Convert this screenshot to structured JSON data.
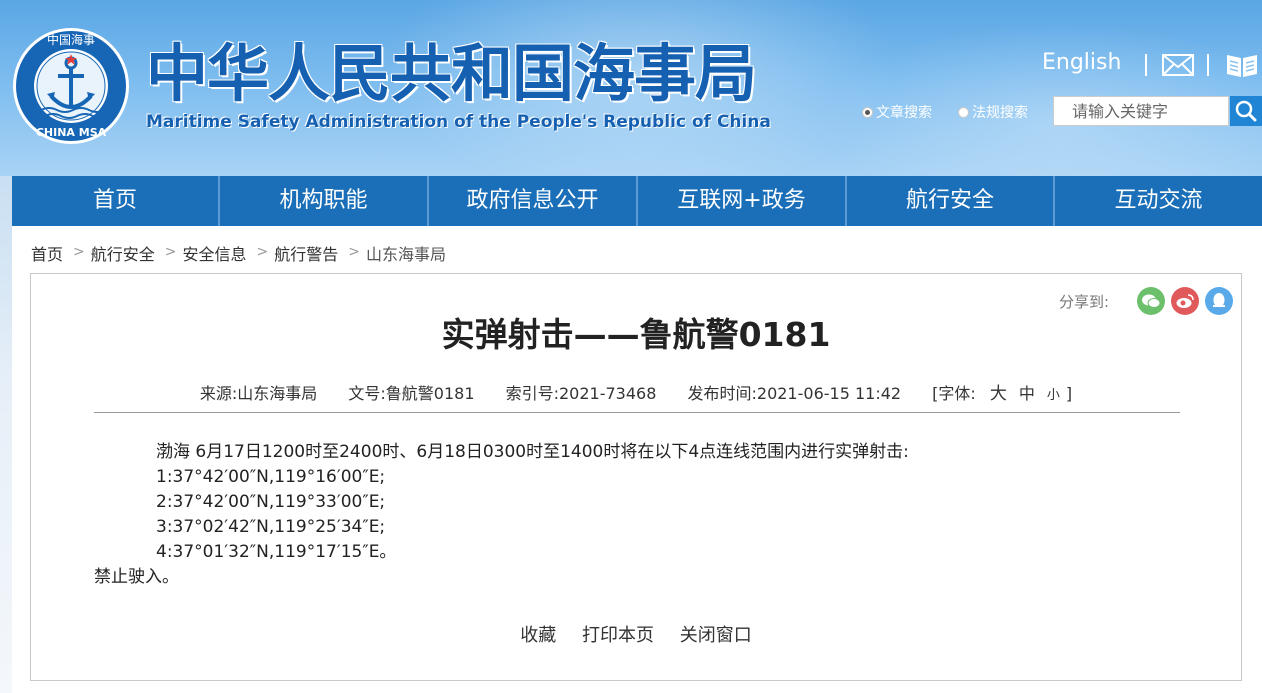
{
  "header": {
    "title_cn": "中华人民共和国海事局",
    "title_en": "Maritime Safety Administration of the People's Republic of China",
    "emblem_text_top": "中国海事",
    "emblem_text_bottom": "CHINA MSA",
    "language_link": "English",
    "icons": [
      "mail-icon",
      "book-icon",
      "search-icon"
    ],
    "search": {
      "options": [
        "文章搜索",
        "法规搜索"
      ],
      "selected": "文章搜索",
      "placeholder": "请输入关键字"
    }
  },
  "nav": {
    "items": [
      "首页",
      "机构职能",
      "政府信息公开",
      "互联网+政务",
      "航行安全",
      "互动交流"
    ]
  },
  "breadcrumb": [
    "首页",
    "航行安全",
    "安全信息",
    "航行警告",
    "山东海事局"
  ],
  "article": {
    "share_label": "分享到:",
    "share_icons": [
      "wechat-icon",
      "weibo-icon",
      "qq-icon"
    ],
    "title": "实弹射击——鲁航警0181",
    "meta": {
      "source": "来源:山东海事局",
      "doc_no": "文号:鲁航警0181",
      "index_no": "索引号:2021-73468",
      "published": "发布时间:2021-06-15 11:42",
      "font_label": "[字体:",
      "font_large": "大",
      "font_medium": "中",
      "font_small": "小",
      "font_close": "]"
    },
    "body": [
      "渤海 6月17日1200时至2400时、6月18日0300时至1400时将在以下4点连线范围内进行实弹射击:",
      "1:37°42′00″N,119°16′00″E;",
      "2:37°42′00″N,119°33′00″E;",
      "3:37°02′42″N,119°25′34″E;",
      "4:37°01′32″N,119°17′15″E。"
    ],
    "closing": "禁止驶入。",
    "actions": [
      "收藏",
      "打印本页",
      "关闭窗口"
    ]
  },
  "colors": {
    "nav_bg": "#1a6fb8",
    "title_blue": "#1660b2",
    "header_sky": "#7cbcef"
  }
}
